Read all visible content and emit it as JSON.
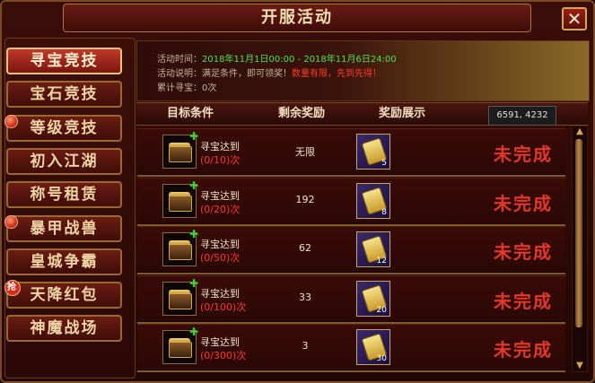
{
  "window": {
    "title": "开服活动",
    "close_label": "✕"
  },
  "sidebar": {
    "items": [
      {
        "label": "寻宝竞技",
        "active": true,
        "badge": ""
      },
      {
        "label": "宝石竞技",
        "active": false,
        "badge": ""
      },
      {
        "label": "等级竞技",
        "active": false,
        "badge": "dot"
      },
      {
        "label": "初入江湖",
        "active": false,
        "badge": ""
      },
      {
        "label": "称号租赁",
        "active": false,
        "badge": ""
      },
      {
        "label": "暴甲战兽",
        "active": false,
        "badge": "dot"
      },
      {
        "label": "皇城争霸",
        "active": false,
        "badge": ""
      },
      {
        "label": "天降红包",
        "active": false,
        "badge": "抢"
      },
      {
        "label": "神魔战场",
        "active": false,
        "badge": ""
      }
    ]
  },
  "info": {
    "time_label": "活动时间：",
    "time_value": "2018年11月1日00:00 - 2018年11月6日24:00",
    "desc_label": "活动说明：满足条件，即可领奖！",
    "desc_highlight": "数量有限，先到先得！",
    "total_label": "累计寻宝：",
    "total_value": "0次"
  },
  "table": {
    "headers": [
      "目标条件",
      "剩余奖励",
      "奖励展示"
    ],
    "coords": "6591, 4232",
    "rows": [
      {
        "cond_title": "寻宝达到",
        "cond_progress": "(0/10)次",
        "remaining": "无限",
        "reward_count": "5",
        "status": "未完成"
      },
      {
        "cond_title": "寻宝达到",
        "cond_progress": "(0/20)次",
        "remaining": "192",
        "reward_count": "8",
        "status": "未完成"
      },
      {
        "cond_title": "寻宝达到",
        "cond_progress": "(0/50)次",
        "remaining": "62",
        "reward_count": "12",
        "status": "未完成"
      },
      {
        "cond_title": "寻宝达到",
        "cond_progress": "(0/100)次",
        "remaining": "33",
        "reward_count": "20",
        "status": "未完成"
      },
      {
        "cond_title": "寻宝达到",
        "cond_progress": "(0/300)次",
        "remaining": "3",
        "reward_count": "30",
        "status": "未完成"
      }
    ]
  },
  "colors": {
    "accent_red": "#e2382b",
    "green": "#4fe04b",
    "gold": "#d3a65a"
  }
}
